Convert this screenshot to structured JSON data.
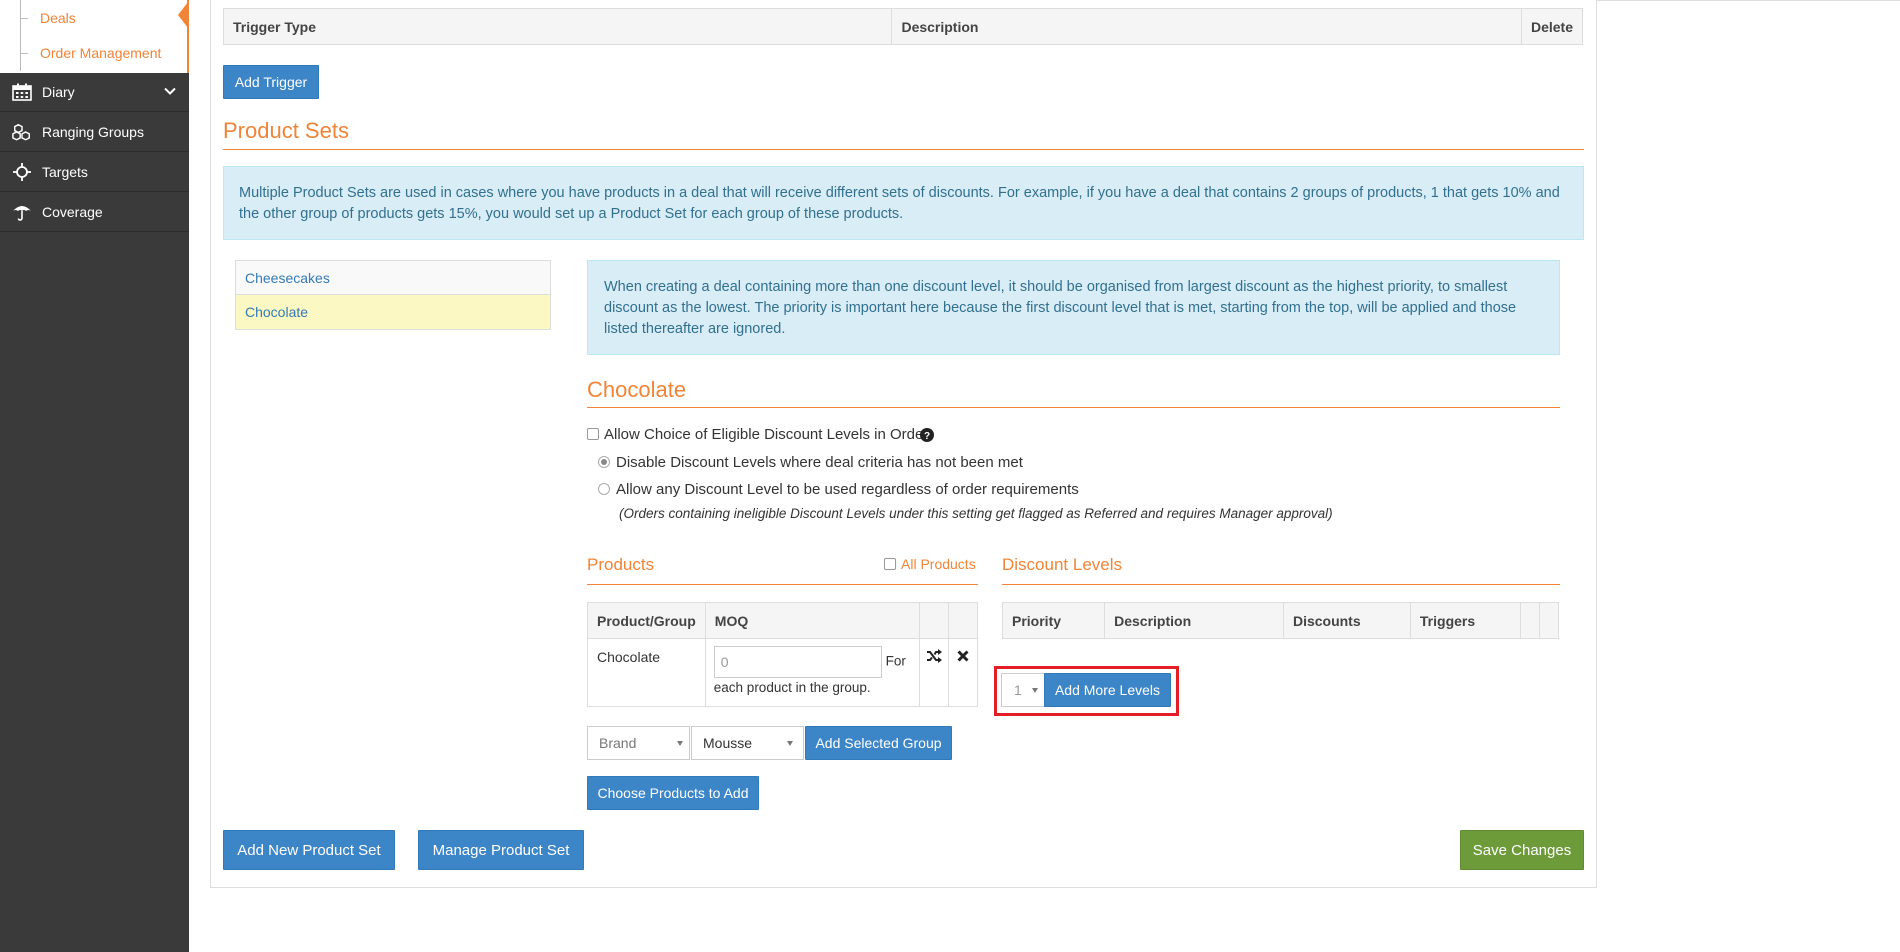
{
  "sidebar": {
    "sub_items": [
      {
        "label": "Deals"
      },
      {
        "label": "Order Management"
      }
    ],
    "items": [
      {
        "label": "Diary",
        "icon": "calendar-icon"
      },
      {
        "label": "Ranging Groups",
        "icon": "cubes-icon"
      },
      {
        "label": "Targets",
        "icon": "crosshair-icon"
      },
      {
        "label": "Coverage",
        "icon": "umbrella-icon"
      }
    ]
  },
  "triggers_table": {
    "headers": [
      "Trigger Type",
      "Description",
      "Delete"
    ]
  },
  "add_trigger_label": "Add Trigger",
  "product_sets": {
    "title": "Product Sets",
    "info": "Multiple Product Sets are used in cases where you have products in a deal that will receive different sets of discounts. For example, if you have a deal that contains 2 groups of products, 1 that gets 10% and the other group of products gets 15%, you would set up a Product Set for each group of these products.",
    "list": [
      "Cheesecakes",
      "Chocolate"
    ],
    "selected": "Chocolate"
  },
  "detail": {
    "info": "When creating a deal containing more than one discount level, it should be organised from largest discount as the highest priority, to smallest discount as the lowest. The priority is important here because the first discount level that is met, starting from the top, will be applied and those listed thereafter are ignored.",
    "title": "Chocolate",
    "allow_choice_label": "Allow Choice of Eligible Discount Levels in Order",
    "allow_choice_checked": false,
    "radio_disable_label": "Disable Discount Levels where deal criteria has not been met",
    "radio_allow_label": "Allow any Discount Level to be used regardless of order requirements",
    "note": "(Orders containing ineligible Discount Levels under this setting get flagged as Referred and requires Manager approval)"
  },
  "products": {
    "title": "Products",
    "all_products_label": "All Products",
    "headers": [
      "Product/Group",
      "MOQ"
    ],
    "rows": [
      {
        "name": "Chocolate",
        "moq_value": "0",
        "moq_suffix": "For",
        "moq_note": "each product in the group."
      }
    ],
    "group_type_select": "Brand",
    "group_value_select": "Mousse",
    "add_selected_group_label": "Add Selected Group",
    "choose_products_label": "Choose Products to Add"
  },
  "discount_levels": {
    "title": "Discount Levels",
    "headers": [
      "Priority",
      "Description",
      "Discounts",
      "Triggers"
    ],
    "count_select": "1",
    "add_more_label": "Add More Levels"
  },
  "footer": {
    "add_new_label": "Add New Product Set",
    "manage_label": "Manage Product Set",
    "save_label": "Save Changes"
  },
  "colors": {
    "accent": "#f08437",
    "primary": "#3c86c8",
    "success": "#6d9b3a",
    "sidebar": "#3a3a3a",
    "highlight": "#e41e26"
  }
}
